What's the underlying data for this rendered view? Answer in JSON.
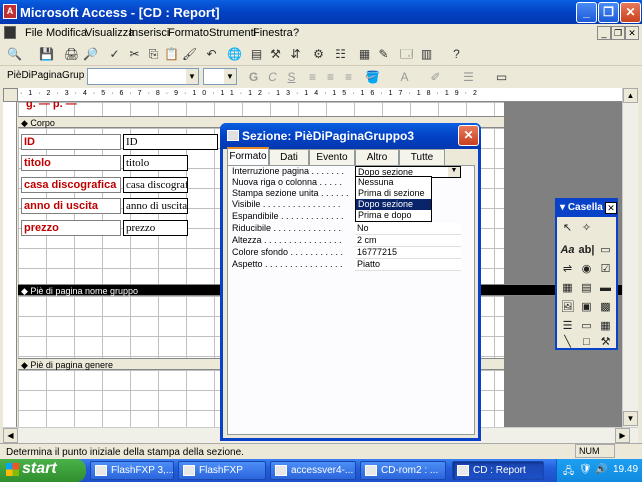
{
  "app": {
    "title": "Microsoft Access - [CD : Report]"
  },
  "menu": [
    "File",
    "Modifica",
    "Visualizza",
    "Inserisci",
    "Formato",
    "Strumenti",
    "Finestra",
    "?"
  ],
  "format_toolbar": {
    "object_combo": "PièDiPaginaGrup",
    "font_combo": "",
    "size_combo": "",
    "bold": "G",
    "italic": "C",
    "underline": "S"
  },
  "ruler": {
    "marks": "·1·2·3·4·5·6·7·8·9·10·11·12·13·14·15·16·17·18·19·2"
  },
  "report": {
    "header_partial": "g. — p. —",
    "sections": {
      "body": "Corpo",
      "group_footer": "Piè di pagina nome gruppo",
      "page_footer": "Piè di pagina genere"
    },
    "labels": [
      "ID",
      "titolo",
      "casa discografica",
      "anno di uscita",
      "prezzo"
    ],
    "fields": [
      "ID",
      "titolo",
      "casa discografica",
      "anno di uscita",
      "prezzo"
    ]
  },
  "dialog": {
    "title": "Sezione: PièDiPaginaGruppo3",
    "tabs": [
      "Formato",
      "Dati",
      "Evento",
      "Altro",
      "Tutte"
    ],
    "properties": [
      {
        "name": "Interruzione pagina . . . . . . .",
        "value": "Dopo sezione"
      },
      {
        "name": "Nuova riga o colonna . . . . .",
        "value": ""
      },
      {
        "name": "Stampa sezione unita . . . . . .",
        "value": ""
      },
      {
        "name": "Visibile . . . . . . . . . . . . . . . .",
        "value": ""
      },
      {
        "name": "Espandibile . . . . . . . . . . . . .",
        "value": ""
      },
      {
        "name": "Riducibile . . . . . . . . . . . . . .",
        "value": "No"
      },
      {
        "name": "Altezza . . . . . . . . . . . . . . . .",
        "value": "2 cm"
      },
      {
        "name": "Colore sfondo . . . . . . . . . . .",
        "value": "16777215"
      },
      {
        "name": "Aspetto . . . . . . . . . . . . . . . .",
        "value": "Piatto"
      }
    ],
    "dropdown_options": [
      "Nessuna",
      "Prima di sezione",
      "Dopo sezione",
      "Prima e dopo"
    ],
    "dropdown_selected": "Dopo sezione"
  },
  "toolbox": {
    "title": "Casella",
    "label_tool": "Aa",
    "textbox_tool": "ab|"
  },
  "status": {
    "text": "Determina il punto iniziale della stampa della sezione.",
    "num": "NUM"
  },
  "taskbar": {
    "start": "start",
    "tasks": [
      "FlashFXP 3,...",
      "FlashFXP",
      "accessver4-...",
      "CD-rom2 : ...",
      "CD : Report"
    ],
    "clock": "19.49"
  }
}
